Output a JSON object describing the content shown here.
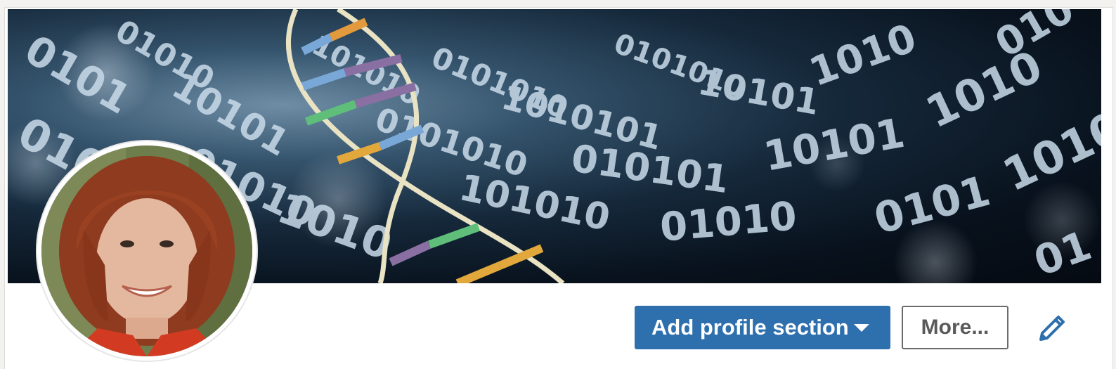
{
  "profile": {
    "add_section_label": "Add profile section",
    "more_label": "More...",
    "banner_icon": "dna-binary-banner-image",
    "avatar_icon": "profile-photo",
    "edit_icon": "pencil-icon"
  },
  "colors": {
    "primary_button": "#2e6fad",
    "secondary_border": "#6b6b6b",
    "edit_icon": "#2e6fad"
  }
}
